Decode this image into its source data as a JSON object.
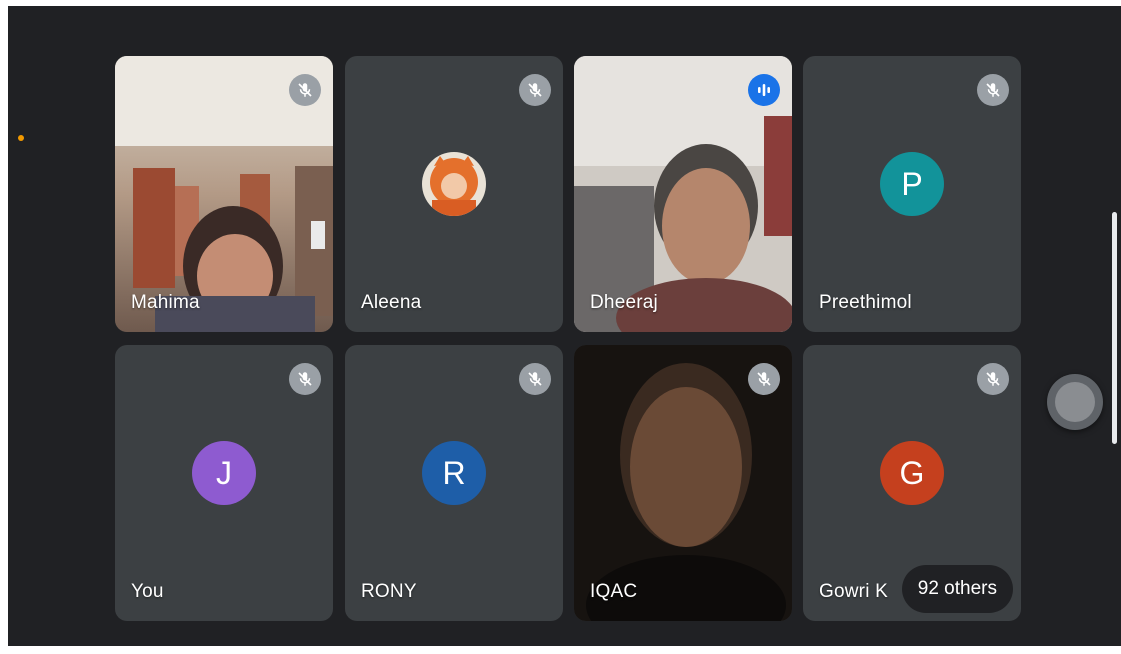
{
  "theme": {
    "background": "#202124",
    "tile_background": "#3c4043",
    "muted_icon_color": "#9aa0a6",
    "speaking_icon_color": "#1a73e8",
    "presence_dot_color": "#f29900"
  },
  "participants": [
    {
      "name": "Mahima",
      "mic": "muted",
      "view": "video"
    },
    {
      "name": "Aleena",
      "mic": "muted",
      "view": "photo-avatar"
    },
    {
      "name": "Dheeraj",
      "mic": "speaking",
      "view": "video"
    },
    {
      "name": "Preethimol",
      "mic": "muted",
      "view": "initial-avatar",
      "initial": "P",
      "color": "#12939a"
    },
    {
      "name": "You",
      "mic": "muted",
      "view": "initial-avatar",
      "initial": "J",
      "color": "#8e5bd0"
    },
    {
      "name": "RONY",
      "mic": "muted",
      "view": "initial-avatar",
      "initial": "R",
      "color": "#1e5ea8"
    },
    {
      "name": "IQAC",
      "mic": "muted",
      "view": "video"
    },
    {
      "name": "Gowri K",
      "mic": "muted",
      "view": "initial-avatar",
      "initial": "G",
      "color": "#c5401e"
    }
  ],
  "others_chip": {
    "label": "92 others"
  },
  "icons": {
    "muted": "mic-off-icon",
    "speaking": "speaking-indicator-icon"
  }
}
